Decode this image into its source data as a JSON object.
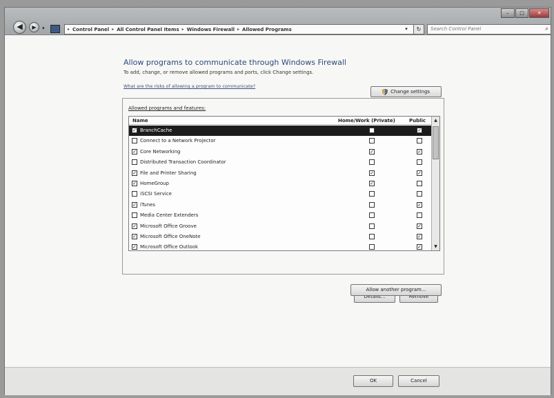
{
  "titlebar": {
    "nav_back": "◀",
    "nav_forward": "▶",
    "breadcrumb": [
      "Control Panel",
      "All Control Panel Items",
      "Windows Firewall",
      "Allowed Programs"
    ],
    "breadcrumb_sep": "▸",
    "dropdown": "▾",
    "refresh": "↻",
    "search_placeholder": "Search Control Panel",
    "search_icon": "⌕",
    "controls": {
      "minimize": "–",
      "maximize": "□",
      "close": "✕"
    }
  },
  "page": {
    "heading": "Allow programs to communicate through Windows Firewall",
    "subtext": "To add, change, or remove allowed programs and ports, click Change settings.",
    "risks_link": "What are the risks of allowing a program to communicate?",
    "change_settings": "Change settings"
  },
  "group": {
    "title": "Allowed programs and features:",
    "col_name": "Name",
    "col_home": "Home/Work (Private)",
    "col_public": "Public"
  },
  "programs": [
    {
      "name": "BranchCache",
      "enabled": true,
      "home": false,
      "public": true
    },
    {
      "name": "Connect to a Network Projector",
      "enabled": false,
      "home": false,
      "public": false
    },
    {
      "name": "Core Networking",
      "enabled": true,
      "home": true,
      "public": true
    },
    {
      "name": "Distributed Transaction Coordinator",
      "enabled": false,
      "home": false,
      "public": false
    },
    {
      "name": "File and Printer Sharing",
      "enabled": true,
      "home": true,
      "public": true
    },
    {
      "name": "HomeGroup",
      "enabled": true,
      "home": true,
      "public": false
    },
    {
      "name": "iSCSI Service",
      "enabled": false,
      "home": false,
      "public": false
    },
    {
      "name": "iTunes",
      "enabled": true,
      "home": false,
      "public": true
    },
    {
      "name": "Media Center Extenders",
      "enabled": false,
      "home": false,
      "public": false
    },
    {
      "name": "Microsoft Office Groove",
      "enabled": true,
      "home": false,
      "public": true
    },
    {
      "name": "Microsoft Office OneNote",
      "enabled": true,
      "home": false,
      "public": true
    },
    {
      "name": "Microsoft Office Outlook",
      "enabled": true,
      "home": false,
      "public": true
    }
  ],
  "selected_index": 0,
  "buttons": {
    "details": "Details...",
    "remove": "Remove",
    "allow_another": "Allow another program...",
    "ok": "OK",
    "cancel": "Cancel"
  },
  "check_glyph": "✓",
  "colors": {
    "heading": "#2b4a7a",
    "selection": "#1c1c1c"
  }
}
